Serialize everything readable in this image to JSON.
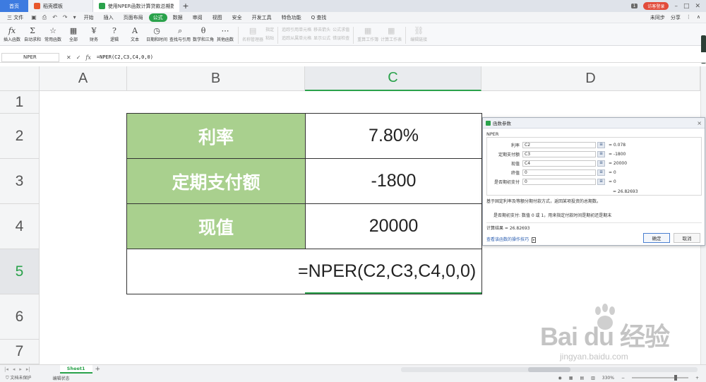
{
  "tabs": {
    "home": "首页",
    "template": "稻壳模板",
    "doc": "使用NPER函数计算贷款总期数",
    "add": "+",
    "badge": "1",
    "login": "访客登录"
  },
  "menu": {
    "file": "三 文件",
    "items": [
      "开始",
      "插入",
      "页面布局",
      "公式",
      "数据",
      "审阅",
      "视图",
      "安全",
      "开发工具",
      "特色功能"
    ],
    "search": "Q 查找",
    "sync": "未同步",
    "share": "分享"
  },
  "ribbon": {
    "insert_fn": "插入函数",
    "autosum": "自动求和",
    "common_fn": "常用函数",
    "all": "全部",
    "finance": "财务",
    "logic": "逻辑",
    "text": "文本",
    "datetime": "日期和时间",
    "lookup": "查找与引用",
    "math": "数学和三角",
    "other_fn": "其他函数",
    "name_mgr": "名称管理器",
    "define": "指定",
    "paste": "粘贴",
    "trace_prec": "追踪引用单元格",
    "trace_dep": "追踪从属单元格",
    "remove_arrows": "移去箭头",
    "show_formula": "显示公式",
    "formula_eval": "公式求值",
    "error_check": "错误检查",
    "recalc": "重算工作簿",
    "calc_sheet": "计算工作表",
    "edit_links": "编辑链接"
  },
  "formula_bar": {
    "name_box": "NPER",
    "formula": "=NPER(C2,C3,C4,0,0)"
  },
  "columns": [
    "A",
    "B",
    "C",
    "D"
  ],
  "rows": [
    "1",
    "2",
    "3",
    "4",
    "5",
    "6",
    "7"
  ],
  "sheet": {
    "rate_label": "利率",
    "rate_value": "7.80%",
    "payment_label": "定期支付额",
    "payment_value": "-1800",
    "pv_label": "现值",
    "pv_value": "20000",
    "formula_display": "=NPER(C2,C3,C4,0,0)"
  },
  "dialog": {
    "title": "函数参数",
    "close": "×",
    "function": "NPER",
    "args": [
      {
        "label": "利率",
        "value": "C2",
        "result": "= 0.078"
      },
      {
        "label": "定期支付额",
        "value": "C3",
        "result": "= -1800"
      },
      {
        "label": "现值",
        "value": "C4",
        "result": "= 20000"
      },
      {
        "label": "终值",
        "value": "0",
        "result": "= 0"
      },
      {
        "label": "是否期初支付",
        "value": "0",
        "result": "= 0"
      }
    ],
    "total_result": "= 26.82693",
    "description": "基于固定利率及等额分期付款方式，返回某项投资的总期数。",
    "param_description": "是否期初支付:  数值 0 或 1，用来指定付款时间是期初还是期末",
    "calc_result": "计算结果 = 26.82693",
    "help_link": "查看该函数的操作技巧",
    "ok": "确定",
    "cancel": "取消"
  },
  "sheet_tab": "Sheet1",
  "status": {
    "protect": "文档未保护",
    "edit_state": "编辑状态",
    "zoom": "330%"
  },
  "watermark": {
    "main": "Bai du 经验",
    "sub": "jingyan.baidu.com"
  }
}
